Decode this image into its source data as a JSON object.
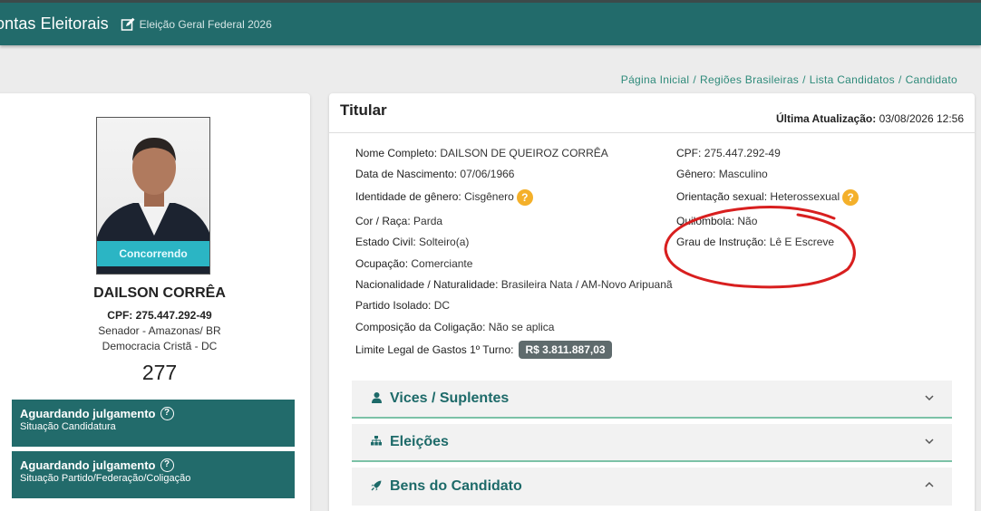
{
  "topbar": {
    "title": "ontas Eleitorais",
    "subtitle": "Eleição Geral Federal 2026",
    "edit_icon": "edit-icon"
  },
  "breadcrumb": [
    "Página Inicial",
    "Regiões Brasileiras",
    "Lista Candidatos",
    "Candidato"
  ],
  "candidate": {
    "status_ribbon": "Concorrendo",
    "name": "DAILSON CORRÊA",
    "cpf": "CPF: 275.447.292-49",
    "role": "Senador - Amazonas/ BR",
    "party": "Democracia Cristã - DC",
    "number": "277"
  },
  "status_boxes": [
    {
      "title": "Aguardando julgamento",
      "sub": "Situação Candidatura"
    },
    {
      "title": "Aguardando julgamento",
      "sub": "Situação Partido/Federação/Coligação"
    }
  ],
  "titular": {
    "heading": "Titular",
    "updated_label": "Última Atualização:",
    "updated_value": "03/08/2026 12:56"
  },
  "fields": {
    "nome_label": "Nome Completo:",
    "nome": "DAILSON DE QUEIROZ CORRÊA",
    "cpf_label": "CPF:",
    "cpf": "275.447.292-49",
    "nasc_label": "Data de Nascimento:",
    "nasc": "07/06/1966",
    "genero_label": "Gênero:",
    "genero": "Masculino",
    "identidade_label": "Identidade de gênero:",
    "identidade": "Cisgênero",
    "orientacao_label": "Orientação sexual:",
    "orientacao": "Heterossexual",
    "cor_label": "Cor / Raça:",
    "cor": "Parda",
    "quilombola_label": "Quilombola:",
    "quilombola": "Não",
    "civil_label": "Estado Civil:",
    "civil": "Solteiro(a)",
    "instrucao_label": "Grau de Instrução:",
    "instrucao": "Lê E Escreve",
    "ocupacao_label": "Ocupação:",
    "ocupacao": "Comerciante",
    "nac_label": "Nacionalidade / Naturalidade:",
    "nac": "Brasileira Nata / AM-Novo Aripuanã",
    "partido_label": "Partido Isolado:",
    "partido": "DC",
    "coligacao_label": "Composição da Coligação:",
    "coligacao": "Não se aplica",
    "limite_label": "Limite Legal de Gastos 1º Turno:",
    "limite": "R$ 3.811.887,03"
  },
  "accordions": [
    {
      "label": "Vices / Suplentes",
      "icon": "user-icon"
    },
    {
      "label": "Eleições",
      "icon": "sitemap-icon"
    },
    {
      "label": "Bens do Candidato",
      "icon": "rocket-icon"
    }
  ],
  "colors": {
    "brand": "#226b6b",
    "accent": "#2bb5c4",
    "help": "#f4b02a",
    "annotation": "#d81f1f"
  }
}
